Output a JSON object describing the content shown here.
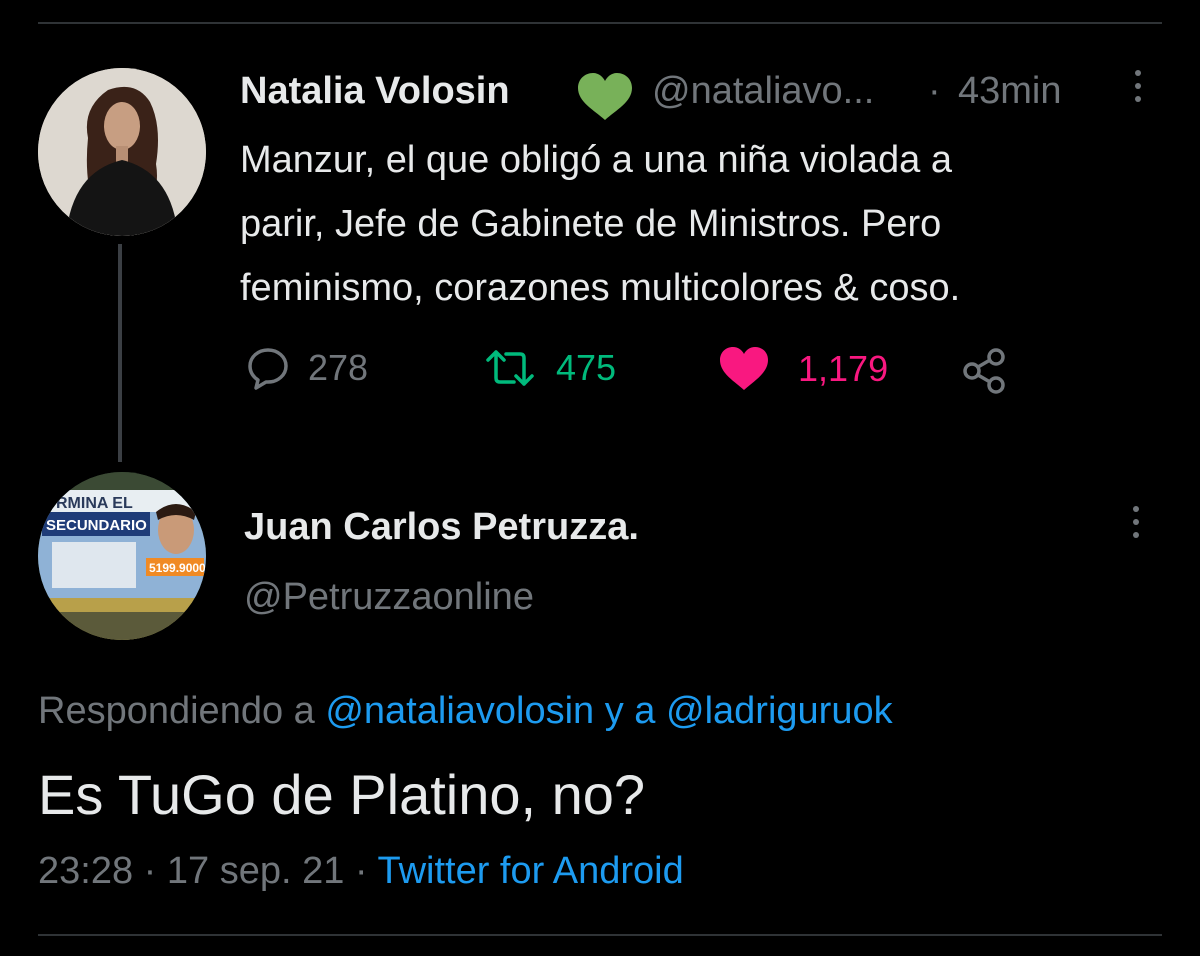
{
  "tweet1": {
    "name": "Natalia Volosin",
    "badge_icon": "green-heart-icon",
    "handle": "@nataliavo...",
    "separator": "·",
    "time": "43min",
    "text_lines": [
      "Manzur, el que obligó a una niña violada a",
      "parir, Jefe de Gabinete de Ministros. Pero",
      "feminismo, corazones multicolores & coso."
    ],
    "actions": {
      "replies": "278",
      "retweets": "475",
      "likes": "1,179"
    },
    "colors": {
      "retweet": "#00ba7c",
      "like": "#f91880",
      "muted": "#71767b"
    }
  },
  "tweet2": {
    "name": "Juan Carlos Petruzza.",
    "handle": "@Petruzzaonline",
    "avatar_text": {
      "line1": "RMINA EL",
      "line2": "SECUNDARIO",
      "phone": "5199.9000"
    },
    "replying_prefix": "Respondiendo a",
    "replying_user1": "@nataliavolosin",
    "replying_join": "y a",
    "replying_user2": "@ladriguruok",
    "text": "Es TuGo de Platino, no?",
    "time": "23:28",
    "separator1": "·",
    "date": "17 sep. 21",
    "separator2": "·",
    "source": "Twitter for Android",
    "link_color": "#1d9bf0"
  }
}
